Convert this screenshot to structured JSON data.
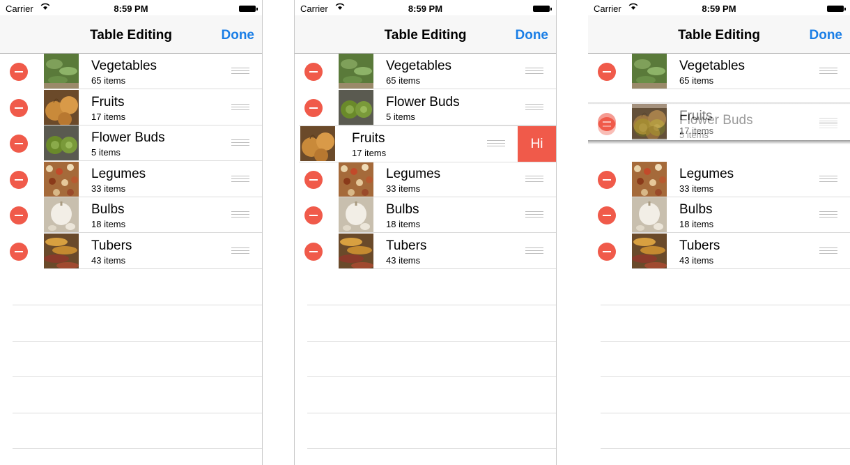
{
  "status": {
    "carrier": "Carrier",
    "wifi_icon": "wifi-icon",
    "time": "8:59 PM",
    "battery_icon": "battery-icon"
  },
  "nav": {
    "title": "Table Editing",
    "done": "Done"
  },
  "rows": [
    {
      "title": "Vegetables",
      "count": "65 items",
      "thumb": "vegetables-thumbnail"
    },
    {
      "title": "Fruits",
      "count": "17 items",
      "thumb": "fruits-thumbnail"
    },
    {
      "title": "Flower Buds",
      "count": "5 items",
      "thumb": "flower-buds-thumbnail"
    },
    {
      "title": "Legumes",
      "count": "33 items",
      "thumb": "legumes-thumbnail"
    },
    {
      "title": "Bulbs",
      "count": "18 items",
      "thumb": "bulbs-thumbnail"
    },
    {
      "title": "Tubers",
      "count": "43 items",
      "thumb": "tubers-thumbnail"
    }
  ],
  "swipe_action": "Hi",
  "colors": {
    "accent": "#1a7ee6",
    "delete": "#f05a4a",
    "navbar": "#f7f7f7"
  }
}
